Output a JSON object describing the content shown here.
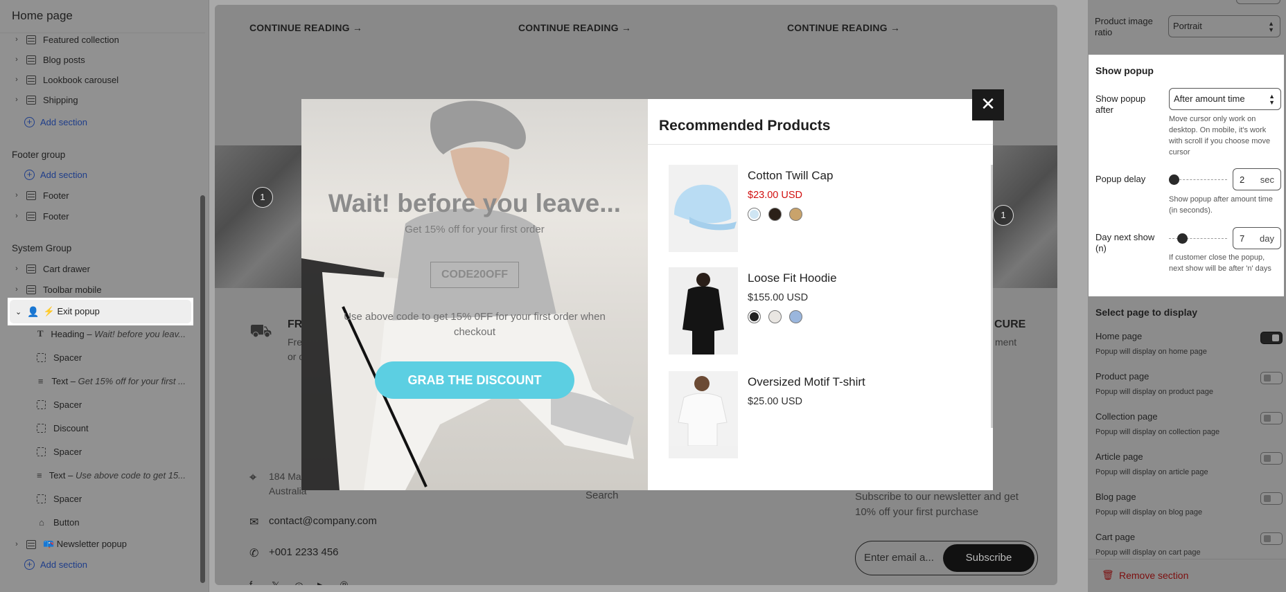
{
  "left_panel": {
    "title": "Home page",
    "sections_top": [
      {
        "label": "Featured collection"
      },
      {
        "label": "Blog posts"
      },
      {
        "label": "Lookbook carousel"
      },
      {
        "label": "Shipping"
      }
    ],
    "add_section": "Add section",
    "footer_group": {
      "title": "Footer group",
      "items": [
        "Footer",
        "Footer"
      ]
    },
    "system_group": {
      "title": "System Group",
      "items": [
        "Cart drawer",
        "Toolbar mobile"
      ]
    },
    "exit_popup": {
      "label": "⚡ Exit popup"
    },
    "blocks": [
      {
        "name": "Heading",
        "detail": "Wait! before you leav..."
      },
      {
        "name": "Spacer",
        "detail": ""
      },
      {
        "name": "Text",
        "detail": "Get 15% off for your first ..."
      },
      {
        "name": "Spacer",
        "detail": ""
      },
      {
        "name": "Discount",
        "detail": ""
      },
      {
        "name": "Spacer",
        "detail": ""
      },
      {
        "name": "Text",
        "detail": "Use above code to get 15..."
      },
      {
        "name": "Spacer",
        "detail": ""
      },
      {
        "name": "Button",
        "detail": ""
      }
    ],
    "newsletter": {
      "label": "📪 Newsletter popup"
    }
  },
  "preview": {
    "continue_reading": "CONTINUE READING",
    "arrow": "→",
    "photo_nums": [
      "1",
      "1"
    ],
    "features": [
      {
        "title": "FR",
        "line1": "Fre",
        "line2": "or c"
      },
      {
        "title": "CURE",
        "line1": "ment",
        "line2": ""
      }
    ],
    "address": {
      "line1": "184 Ma",
      "line2": "Australia"
    },
    "email": "contact@company.com",
    "phone": "+001 2233 456",
    "search_link": "Search",
    "newsletter_text": "Subscribe to our newsletter and get 10% off your first purchase",
    "newsletter_placeholder": "Enter email a...",
    "subscribe_label": "Subscribe",
    "social": [
      "f",
      "𝕏",
      "◎",
      "▶",
      "℗"
    ]
  },
  "popup": {
    "heading": "Wait! before you leave...",
    "subtext": "Get 15% off for your first order",
    "code": "CODE20OFF",
    "note": "Use above code to get 15% 0FF for your first order when checkout",
    "button": "GRAB THE DISCOUNT",
    "close": "✕",
    "recommended_title": "Recommended Products",
    "products": [
      {
        "name": "Cotton Twill Cap",
        "price": "$23.00 USD",
        "sale": true,
        "swatches": [
          "#cfe5f3",
          "#2b2018",
          "#c9a36b"
        ]
      },
      {
        "name": "Loose Fit Hoodie",
        "price": "$155.00 USD",
        "sale": false,
        "swatches": [
          "#222222",
          "#e9e6e2",
          "#9ab6dd"
        ]
      },
      {
        "name": "Oversized Motif T-shirt",
        "price": "$25.00 USD",
        "sale": false,
        "swatches": []
      }
    ]
  },
  "right_panel": {
    "product_image_ratio": {
      "label": "Product image ratio",
      "value": "Portrait"
    },
    "show_popup": {
      "heading": "Show popup",
      "after_label": "Show popup after",
      "after_value": "After amount time",
      "after_help": "Move cursor only work on desktop. On mobile, it's work with scroll if you choose move cursor",
      "delay_label": "Popup delay",
      "delay_value": "2",
      "delay_unit": "sec",
      "delay_help": "Show popup after amount time (in seconds).",
      "nextday_label": "Day next show (n)",
      "nextday_value": "7",
      "nextday_unit": "day",
      "nextday_help": "If customer close the popup, next show will be after 'n' days"
    },
    "select_page_title": "Select page to display",
    "pages": [
      {
        "title": "Home page",
        "desc": "Popup will display on home page",
        "on": true
      },
      {
        "title": "Product page",
        "desc": "Popup will display on product page",
        "on": false
      },
      {
        "title": "Collection page",
        "desc": "Popup will display on collection page",
        "on": false
      },
      {
        "title": "Article page",
        "desc": "Popup will display on article page",
        "on": false
      },
      {
        "title": "Blog page",
        "desc": "Popup will display on blog page",
        "on": false
      },
      {
        "title": "Cart page",
        "desc": "Popup will display on cart page",
        "on": false
      }
    ],
    "remove_section": "Remove section"
  },
  "colors": {
    "accent_button": "#5ccfe2",
    "sale_price": "#d10f0f",
    "remove_text": "#7c0e0e",
    "link": "#1e3d8a"
  }
}
